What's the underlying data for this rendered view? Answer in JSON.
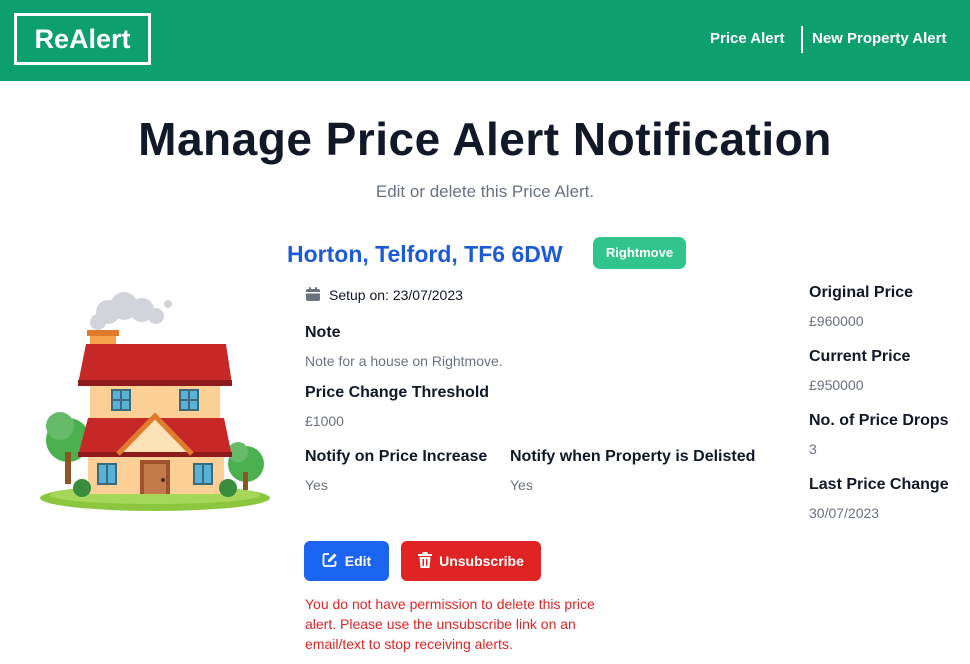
{
  "header": {
    "logo": "ReAlert",
    "nav": [
      {
        "label": "Price Alert"
      },
      {
        "label": "New Property Alert"
      }
    ],
    "brand_color": "#0e9f6e"
  },
  "page": {
    "title": "Manage Price Alert Notification",
    "subtitle": "Edit or delete this Price Alert."
  },
  "alert": {
    "address": "Horton, Telford, TF6 6DW",
    "source_badge": "Rightmove",
    "setup_text": "Setup on: 23/07/2023",
    "note_label": "Note",
    "note_value": "Note for a house on Rightmove.",
    "threshold_label": "Price Change Threshold",
    "threshold_value": "£1000",
    "notify_increase_label": "Notify on Price Increase",
    "notify_increase_value": "Yes",
    "notify_delisted_label": "Notify when Property is Delisted",
    "notify_delisted_value": "Yes"
  },
  "stats": {
    "original_price_label": "Original Price",
    "original_price_value": "£960000",
    "current_price_label": "Current Price",
    "current_price_value": "£950000",
    "price_drops_label": "No. of Price Drops",
    "price_drops_value": "3",
    "last_change_label": "Last Price Change",
    "last_change_value": "30/07/2023"
  },
  "actions": {
    "edit_label": "Edit",
    "edit_icon": "edit-icon",
    "unsubscribe_label": "Unsubscribe",
    "unsubscribe_icon": "trash-icon",
    "warning": "You do not have permission to delete this price alert. Please use the unsubscribe link on an email/text to stop receiving alerts."
  }
}
